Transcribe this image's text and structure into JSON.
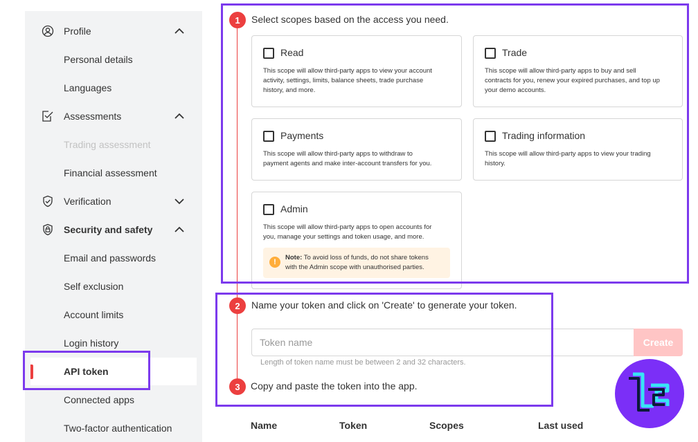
{
  "sidebar": {
    "items": [
      {
        "label": "Profile",
        "icon": "user-icon",
        "chevron": "up"
      },
      {
        "label": "Personal details"
      },
      {
        "label": "Languages"
      },
      {
        "label": "Assessments",
        "icon": "assessment-icon",
        "chevron": "up"
      },
      {
        "label": "Trading assessment",
        "disabled": true
      },
      {
        "label": "Financial assessment"
      },
      {
        "label": "Verification",
        "icon": "shield-check-icon",
        "chevron": "down"
      },
      {
        "label": "Security and safety",
        "icon": "lock-shield-icon",
        "chevron": "up"
      },
      {
        "label": "Email and passwords"
      },
      {
        "label": "Self exclusion"
      },
      {
        "label": "Account limits"
      },
      {
        "label": "Login history"
      },
      {
        "label": "API token",
        "active": true
      },
      {
        "label": "Connected apps"
      },
      {
        "label": "Two-factor authentication"
      }
    ]
  },
  "steps": [
    {
      "number": "1",
      "text": "Select scopes based on the access you need."
    },
    {
      "number": "2",
      "text": "Name your token and click on 'Create' to generate your token."
    },
    {
      "number": "3",
      "text": "Copy and paste the token into the app."
    }
  ],
  "scopes": {
    "read": {
      "title": "Read",
      "desc1": "This scope will allow third-party apps to view your account",
      "desc2": "activity, settings, limits, balance sheets, trade purchase",
      "desc3": "history, and more."
    },
    "trade": {
      "title": "Trade",
      "desc1": "This scope will allow third-party apps to buy and sell",
      "desc2": "contracts for you, renew your expired purchases, and top up",
      "desc3": "your demo accounts."
    },
    "payments": {
      "title": "Payments",
      "desc1": "This scope will allow third-party apps to withdraw to",
      "desc2": "payment agents and make inter-account transfers for you."
    },
    "trading_info": {
      "title": "Trading information",
      "desc1": "This scope will allow third-party apps to view your trading",
      "desc2": "history."
    },
    "admin": {
      "title": "Admin",
      "desc1": "This scope will allow third-party apps to open accounts for",
      "desc2": "you, manage your settings and token usage, and more.",
      "note_label": "Note:",
      "note1": " To avoid loss of funds, do not share tokens",
      "note2": "with the Admin scope with unauthorised parties."
    }
  },
  "token_form": {
    "placeholder": "Token name",
    "create_label": "Create",
    "hint": "Length of token name must be between 2 and 32 characters."
  },
  "table": {
    "headers": [
      "Name",
      "Token",
      "Scopes",
      "Last used"
    ]
  },
  "colors": {
    "accent": "#ec3f3f",
    "highlight": "#7c3aed",
    "create_disabled": "#ffc5c5",
    "logo_bg": "#7b2ff7",
    "logo_stroke": "#38e4f5"
  }
}
